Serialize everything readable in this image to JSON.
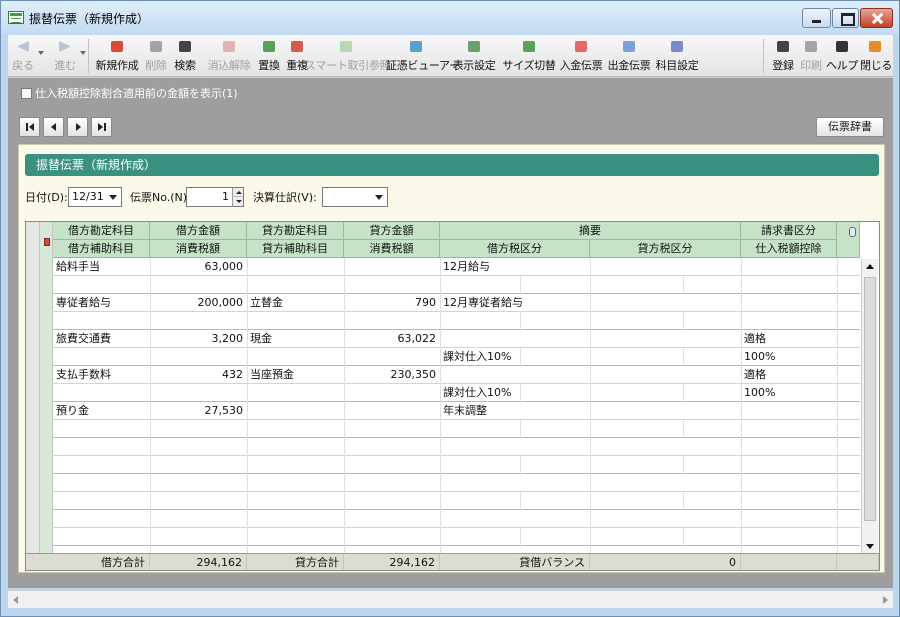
{
  "window": {
    "title": "振替伝票（新規作成）"
  },
  "toolbar": {
    "buttons": [
      {
        "key": "back",
        "label": "戻る",
        "icon": "arrow-left-icon",
        "enabled": false
      },
      {
        "key": "forward",
        "label": "進む",
        "icon": "arrow-right-icon",
        "enabled": false
      },
      {
        "key": "new",
        "label": "新規作成",
        "icon": "new-document-icon",
        "enabled": true
      },
      {
        "key": "delete",
        "label": "削除",
        "icon": "delete-icon",
        "enabled": false,
        "shortcut": "F3"
      },
      {
        "key": "search",
        "label": "検索",
        "icon": "search-icon",
        "enabled": true,
        "shortcut": "F3"
      },
      {
        "key": "cancel-clear",
        "label": "消込解除",
        "icon": "clear-icon",
        "enabled": false
      },
      {
        "key": "replace",
        "label": "置換",
        "icon": "replace-icon",
        "enabled": true
      },
      {
        "key": "duplicate",
        "label": "重複",
        "icon": "duplicate-icon",
        "enabled": true
      },
      {
        "key": "smart",
        "label": "スマート取引参照",
        "icon": "smart-trade-icon",
        "enabled": false
      },
      {
        "key": "viewer",
        "label": "証憑ビューアー",
        "icon": "voucher-viewer-icon",
        "enabled": true
      },
      {
        "key": "display",
        "label": "表示設定",
        "icon": "display-settings-icon",
        "enabled": true
      },
      {
        "key": "size",
        "label": "サイズ切替",
        "icon": "size-switch-icon",
        "enabled": true
      },
      {
        "key": "receipt",
        "label": "入金伝票",
        "icon": "receipt-slip-icon",
        "enabled": true
      },
      {
        "key": "payment",
        "label": "出金伝票",
        "icon": "payment-slip-icon",
        "enabled": true
      },
      {
        "key": "account",
        "label": "科目設定",
        "icon": "account-settings-icon",
        "enabled": true
      },
      {
        "key": "register",
        "label": "登録",
        "icon": "register-icon",
        "enabled": true,
        "shortcut": "F12"
      },
      {
        "key": "print",
        "label": "印刷",
        "icon": "print-icon",
        "enabled": false,
        "shortcut": "F1"
      },
      {
        "key": "help",
        "label": "ヘルプ",
        "icon": "help-icon",
        "enabled": true,
        "shortcut": "F1"
      },
      {
        "key": "close",
        "label": "閉じる",
        "icon": "close-app-icon",
        "enabled": true
      }
    ]
  },
  "options": {
    "tax_checkbox_label": "仕入税額控除割合適用前の金額を表示(1)",
    "tax_checkbox_checked": false
  },
  "dictionary_button": "伝票辞書",
  "panel": {
    "title": "振替伝票（新規作成）",
    "date_label": "日付(D):",
    "date_value": "12/31",
    "slip_no_label": "伝票No.(N):",
    "slip_no_value": "1",
    "closing_label": "決算仕訳(V):",
    "closing_value": ""
  },
  "grid": {
    "headers_top": [
      "借方勘定科目",
      "借方金額",
      "貸方勘定科目",
      "貸方金額",
      "摘要",
      "請求書区分"
    ],
    "headers_bottom": [
      "借方補助科目",
      "消費税額",
      "貸方補助科目",
      "消費税額",
      "借方税区分",
      "貸方税区分",
      "仕入税額控除"
    ],
    "rows": [
      {
        "d_acct": "給料手当",
        "d_amt": "63,000",
        "c_acct": "",
        "c_amt": "",
        "memo": "12月給与",
        "d_tax": "",
        "c_tax": "",
        "inv": "",
        "d_sub": "",
        "d_vat": "",
        "c_sub": "",
        "c_vat": "",
        "ded": ""
      },
      {
        "d_acct": "専従者給与",
        "d_amt": "200,000",
        "c_acct": "立替金",
        "c_amt": "790",
        "memo": "12月専従者給与",
        "d_tax": "",
        "c_tax": "",
        "inv": "",
        "d_sub": "",
        "d_vat": "",
        "c_sub": "",
        "c_vat": "",
        "ded": ""
      },
      {
        "d_acct": "旅費交通費",
        "d_amt": "3,200",
        "c_acct": "現金",
        "c_amt": "63,022",
        "memo": "",
        "d_tax": "課対仕入10%",
        "c_tax": "",
        "inv": "適格",
        "d_sub": "",
        "d_vat": "",
        "c_sub": "",
        "c_vat": "",
        "ded": "100%"
      },
      {
        "d_acct": "支払手数料",
        "d_amt": "432",
        "c_acct": "当座預金",
        "c_amt": "230,350",
        "memo": "",
        "d_tax": "課対仕入10%",
        "c_tax": "",
        "inv": "適格",
        "d_sub": "",
        "d_vat": "",
        "c_sub": "",
        "c_vat": "",
        "ded": "100%"
      },
      {
        "d_acct": "預り金",
        "d_amt": "27,530",
        "c_acct": "",
        "c_amt": "",
        "memo": "年末調整",
        "d_tax": "",
        "c_tax": "",
        "inv": "",
        "d_sub": "",
        "d_vat": "",
        "c_sub": "",
        "c_vat": "",
        "ded": ""
      }
    ],
    "footer": {
      "debit_total_label": "借方合計",
      "debit_total": "294,162",
      "credit_total_label": "貸方合計",
      "credit_total": "294,162",
      "balance_label": "貸借バランス",
      "balance": "0"
    }
  }
}
